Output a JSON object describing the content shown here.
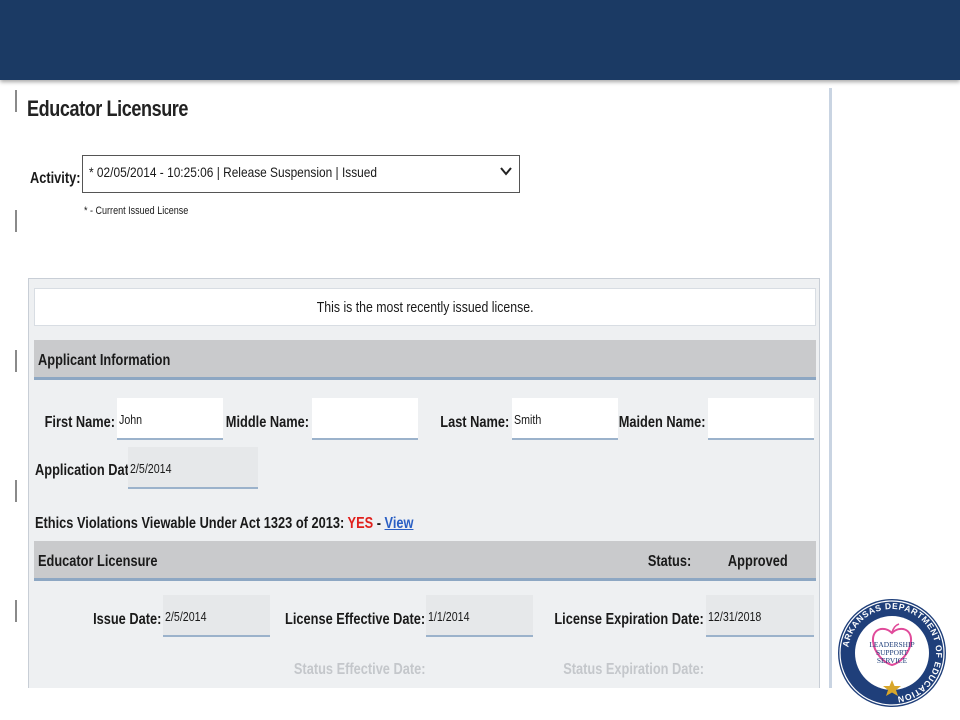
{
  "page": {
    "title": "Educator Licensure"
  },
  "activity": {
    "label": "Activity:",
    "selected": "* 02/05/2014 - 10:25:06 | Release Suspension | Issued",
    "note": "* - Current Issued License"
  },
  "notice": "This is the most recently issued license.",
  "applicant": {
    "section_title": "Applicant Information",
    "first_name_label": "First Name:",
    "first_name": "John",
    "middle_name_label": "Middle Name:",
    "middle_name": "",
    "last_name_label": "Last Name:",
    "last_name": "Smith",
    "maiden_name_label": "Maiden Name:",
    "maiden_name": "",
    "application_date_label": "Application Date:",
    "application_date": "2/5/2014"
  },
  "ethics": {
    "label": "Ethics Violations Viewable Under Act 1323 of 2013:",
    "value": "YES",
    "separator": " - ",
    "link": "View"
  },
  "licensure": {
    "section_title": "Educator Licensure",
    "status_label": "Status:",
    "status_value": "Approved",
    "issue_date_label": "Issue Date:",
    "issue_date": "2/5/2014",
    "effective_date_label": "License Effective Date:",
    "effective_date": "1/1/2014",
    "expiration_date_label": "License Expiration Date:",
    "expiration_date": "12/31/2018",
    "status_effective_label": "Status Effective Date:",
    "status_expiration_label": "Status Expiration Date:"
  },
  "logo": {
    "ring_text": "ARKANSAS DEPARTMENT OF EDUCATION",
    "line1": "LEADERSHIP",
    "line2": "SUPPORT",
    "line3": "SERVICE"
  },
  "colors": {
    "banner": "#1b3a64",
    "yes": "#e0201c",
    "link": "#2a5fc4",
    "logo_blue": "#1f3f7a",
    "logo_gold": "#d8a62a",
    "logo_apple": "#e04a9a"
  }
}
